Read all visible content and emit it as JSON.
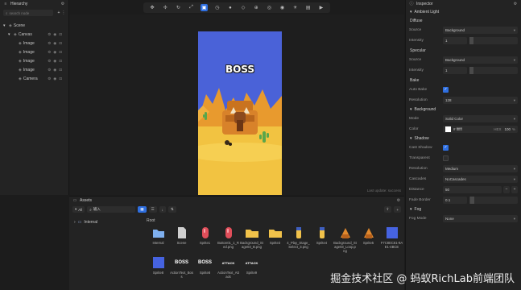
{
  "hierarchy": {
    "title": "Hierarchy",
    "search_placeholder": "search node",
    "tree": [
      {
        "label": "Scene",
        "indent": 0,
        "caret": "▾",
        "tools": false
      },
      {
        "label": "Canvas",
        "indent": 1,
        "caret": "▾",
        "tools": true
      },
      {
        "label": "Image",
        "indent": 2,
        "caret": "",
        "tools": true
      },
      {
        "label": "Image",
        "indent": 2,
        "caret": "",
        "tools": true
      },
      {
        "label": "Image",
        "indent": 2,
        "caret": "",
        "tools": true
      },
      {
        "label": "Image",
        "indent": 2,
        "caret": "",
        "tools": true
      },
      {
        "label": "Camera",
        "indent": 2,
        "caret": "",
        "tools": true
      }
    ]
  },
  "toolbar": {
    "buttons": [
      "hand",
      "move",
      "rotate",
      "scale",
      "rect",
      "anchor",
      "circle",
      "diamond",
      "pivot",
      "global",
      "camera",
      "light",
      "grid",
      "play"
    ],
    "active_index": 4
  },
  "scene": {
    "game_title": "BOSS",
    "hint": "Last update: success"
  },
  "inspector": {
    "title": "Inspector",
    "ambient_light": {
      "section": "Ambient Light",
      "diffuse": "Diffuse",
      "diffuse_source_label": "Source",
      "diffuse_source_value": "Background",
      "diffuse_intensity_label": "Intensity",
      "diffuse_intensity_value": "1",
      "diffuse_intensity_fraction": 0.08,
      "specular": "Specular",
      "specular_source_label": "Source",
      "specular_source_value": "Background",
      "specular_intensity_label": "Intensity",
      "specular_intensity_value": "1",
      "specular_intensity_fraction": 0.08,
      "bake": "Bake",
      "auto_bake_label": "Auto Bake",
      "auto_bake_checked": true,
      "resolution_label": "Resolution",
      "resolution_value": "128"
    },
    "background": {
      "section": "Background",
      "mode_label": "Mode",
      "mode_value": "Solid Color",
      "color_label": "Color",
      "color_hex": "ffffff",
      "color_text": "# ffffff",
      "color_format": "HEX",
      "color_alpha": "100",
      "color_alpha_unit": "%"
    },
    "shadow": {
      "section": "Shadow",
      "cast_shadow_label": "Cast Shadow",
      "cast_shadow_checked": true,
      "transparent_label": "Transparent",
      "transparent_checked": false,
      "resolution_label": "Resolution",
      "resolution_value": "Medium",
      "cascades_label": "Cascades",
      "cascades_value": "NoCascades",
      "distance_label": "Distance",
      "distance_value": "50",
      "distance_minus": "−",
      "distance_plus": "+",
      "fade_border_label": "Fade Border",
      "fade_border_value": "0.1",
      "fade_border_fraction": 0.1
    },
    "fog": {
      "section": "Fog",
      "fog_mode_label": "Fog Mode",
      "fog_mode_value": "None"
    }
  },
  "assets": {
    "title": "Assets",
    "filter_label": "All",
    "search_placeholder": "输入",
    "left_tree_label": "Internal",
    "root_label": "Root",
    "items": [
      {
        "name": "Internal",
        "kind": "folder-blue"
      },
      {
        "name": "Scene",
        "kind": "doc"
      },
      {
        "name": "Sprite1",
        "kind": "pill-red"
      },
      {
        "name": "Button01_1_Red.png",
        "kind": "pill-red"
      },
      {
        "name": "Background_Stage03_B.png",
        "kind": "folder-yellow"
      },
      {
        "name": "Sprite3",
        "kind": "folder-yellow"
      },
      {
        "name": "4_Play_Stage_Select_3.png",
        "kind": "tube"
      },
      {
        "name": "Sprite4",
        "kind": "tube"
      },
      {
        "name": "Background_Stage03_Loop.png",
        "kind": "cake"
      },
      {
        "name": "Sprite5",
        "kind": "cake"
      },
      {
        "name": "F7C8EC61-9AE1-4BCE",
        "kind": "blue-square"
      },
      {
        "name": "Sprite8",
        "kind": "blue-square"
      },
      {
        "name": "ActionText_Boss",
        "kind": "boss"
      },
      {
        "name": "Sprite8",
        "kind": "boss"
      },
      {
        "name": "ActionText_Attack",
        "kind": "attack"
      },
      {
        "name": "Sprite9",
        "kind": "attack"
      }
    ]
  },
  "watermark": "掘金技术社区 @ 蚂蚁RichLab前端团队",
  "colors": {
    "accent": "#2f6fe0",
    "game_sky": "#4a62d8",
    "desert": "#f2b53a"
  }
}
